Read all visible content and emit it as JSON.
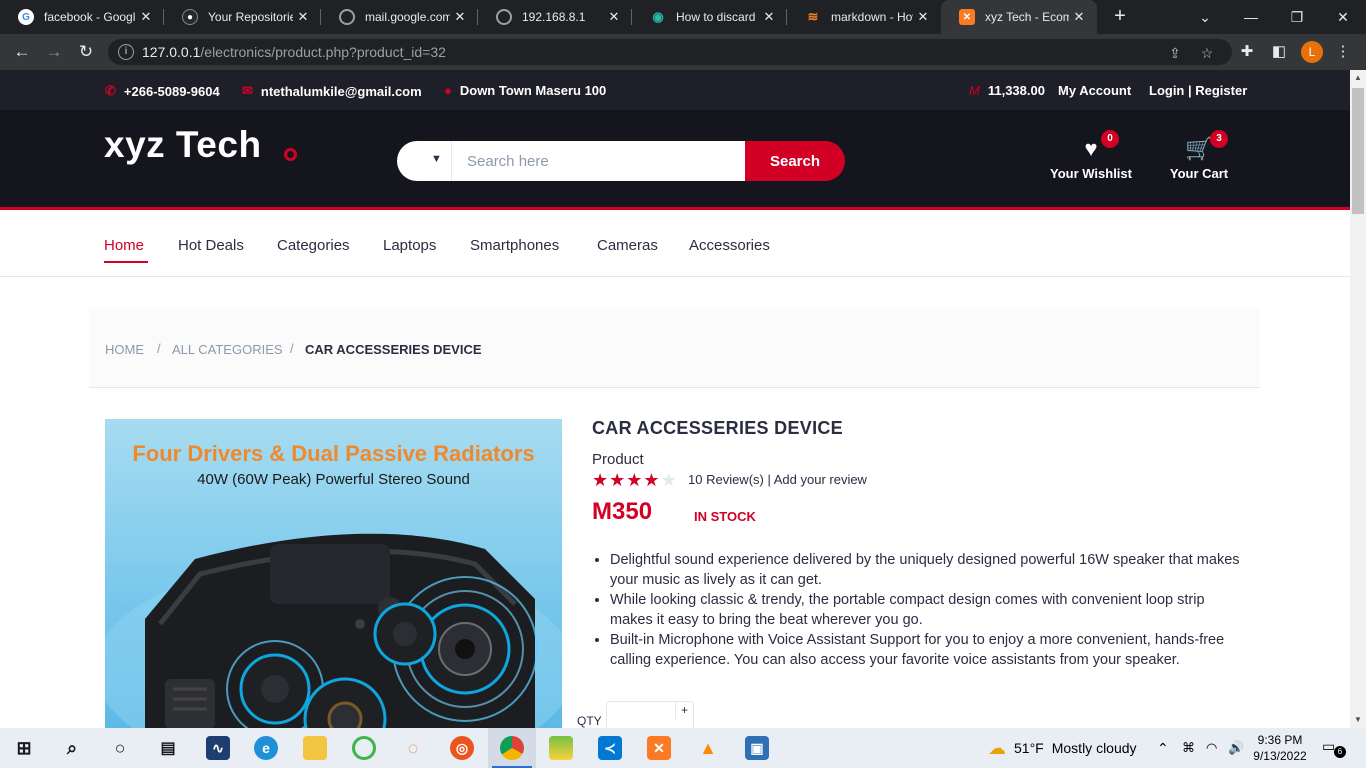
{
  "browser": {
    "tabs": [
      {
        "title": "facebook - Googl",
        "icon": "google-icon"
      },
      {
        "title": "Your Repositories",
        "icon": "github-icon"
      },
      {
        "title": "mail.google.com",
        "icon": "globe-icon"
      },
      {
        "title": "192.168.8.1",
        "icon": "globe-icon"
      },
      {
        "title": "How to discard y",
        "icon": "tab-icon"
      },
      {
        "title": "markdown - How",
        "icon": "stackoverflow-icon"
      },
      {
        "title": "xyz Tech - Ecomm",
        "icon": "xampp-icon"
      }
    ],
    "url_host": "127.0.0.1",
    "url_path": "/electronics/product.php?product_id=32",
    "profile_initial": "L"
  },
  "topbar": {
    "phone": "+266-5089-9604",
    "email": "ntethalumkile@gmail.com",
    "address": "Down Town Maseru 100",
    "currency_symbol": "M",
    "balance": "11,338.00",
    "my_account": "My Account",
    "login_register": "Login | Register"
  },
  "header": {
    "logo": "xyz Tech",
    "search_placeholder": "Search here",
    "search_button": "Search",
    "wishlist_label": "Your Wishlist",
    "wishlist_count": "0",
    "cart_label": "Your Cart",
    "cart_count": "3"
  },
  "nav": {
    "items": [
      "Home",
      "Hot Deals",
      "Categories",
      "Laptops",
      "Smartphones",
      "Cameras",
      "Accessories"
    ],
    "active": "Home"
  },
  "breadcrumb": {
    "items": [
      "Home",
      "All Categories",
      "Car Accesseries Device"
    ]
  },
  "product": {
    "name": "CAR ACCESSERIES DEVICE",
    "category": "Product",
    "rating": 4,
    "rating_max": 5,
    "reviews": "10 Review(s) | Add your review",
    "price": "M350",
    "stock": "In Stock",
    "image_heading": "Four Drivers & Dual Passive Radiators",
    "image_subheading": "40W (60W Peak) Powerful Stereo Sound",
    "features": [
      "Delightful sound experience delivered by the uniquely designed powerful 16W speaker that makes your music as lively as it can get.",
      "While looking classic & trendy, the portable compact design comes with convenient loop strip makes it easy to bring the beat wherever you go.",
      "Built-in Microphone with Voice Assistant Support for you to enjoy a more convenient, hands-free calling experience. You can also access your favorite voice assistants from your speaker."
    ],
    "qty_label": "QTY"
  },
  "taskbar": {
    "weather_temp": "51°F",
    "weather_text": "Mostly cloudy",
    "time": "9:36 PM",
    "date": "9/13/2022",
    "notifications": "6"
  },
  "colors": {
    "accent": "#D10024",
    "header_dark": "#15161D",
    "topbar_dark": "#1E1F29",
    "text": "#2B2D42"
  }
}
